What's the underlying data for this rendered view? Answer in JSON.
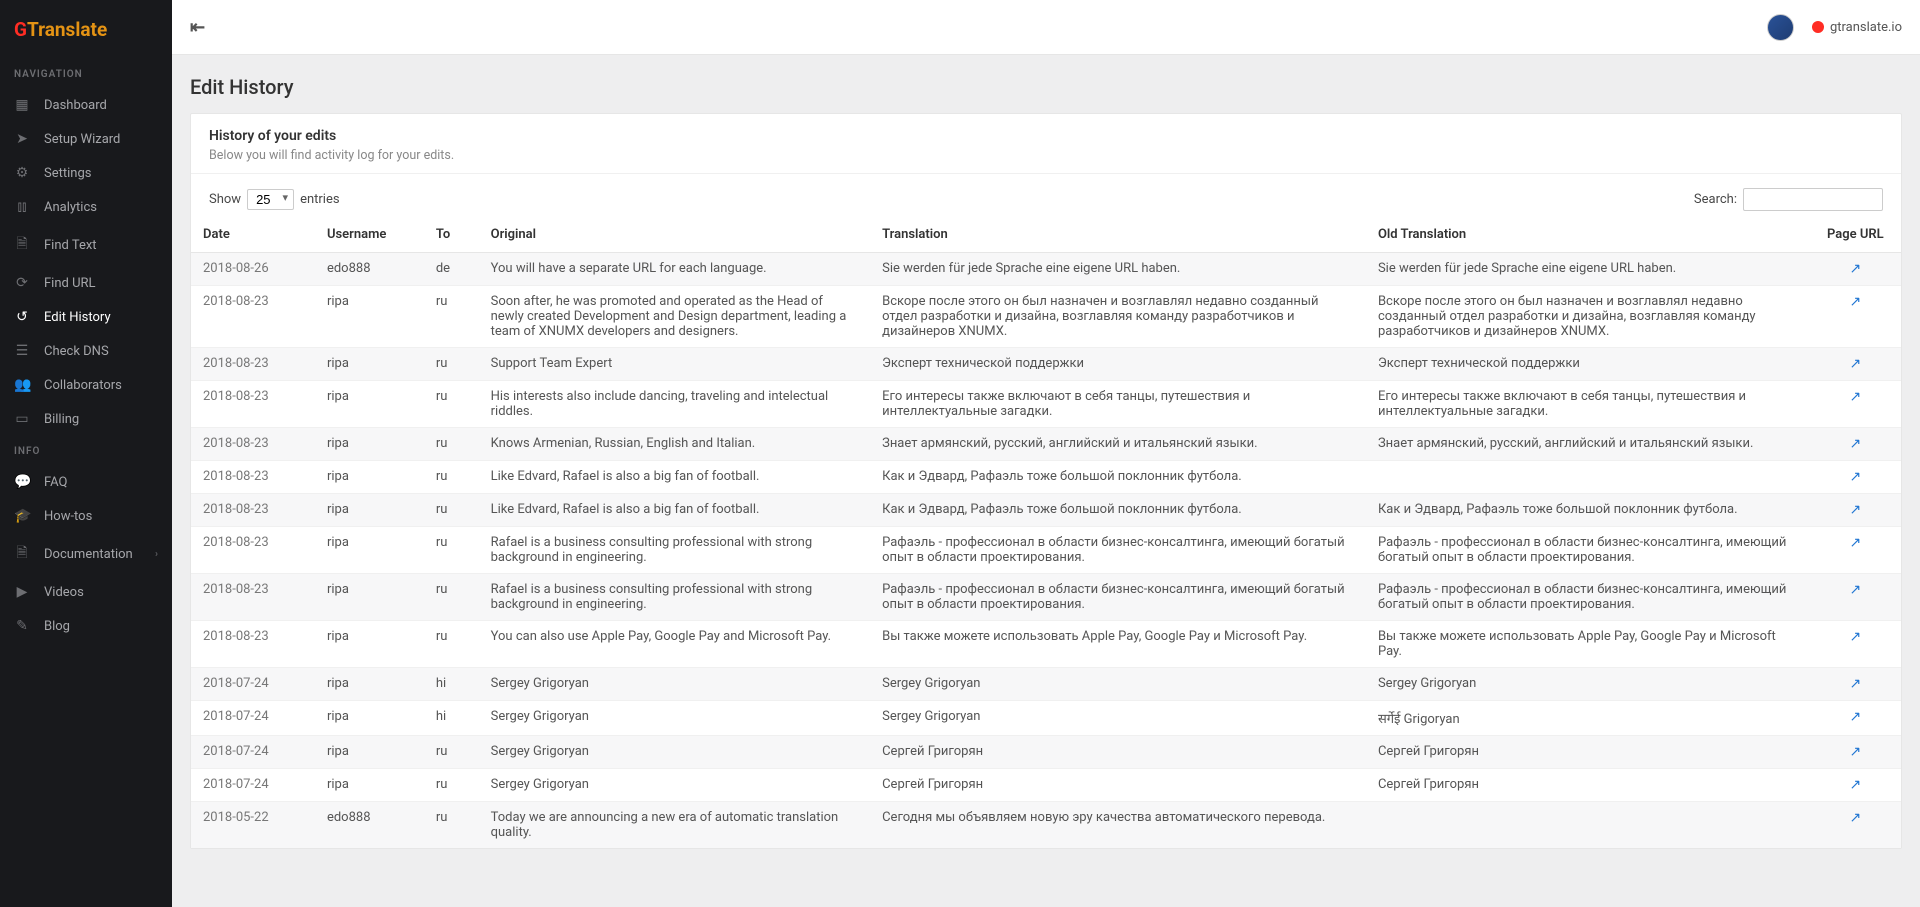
{
  "logo": {
    "gt": "G",
    "rest": "Translate"
  },
  "nav_sections": {
    "navigation_label": "NAVIGATION",
    "info_label": "INFO"
  },
  "nav": {
    "dashboard": "Dashboard",
    "setup_wizard": "Setup Wizard",
    "settings": "Settings",
    "analytics": "Analytics",
    "find_text": "Find Text",
    "find_url": "Find URL",
    "edit_history": "Edit History",
    "check_dns": "Check DNS",
    "collaborators": "Collaborators",
    "billing": "Billing",
    "faq": "FAQ",
    "howtos": "How-tos",
    "documentation": "Documentation",
    "videos": "Videos",
    "blog": "Blog"
  },
  "topbar": {
    "brand_link": "gtranslate.io"
  },
  "page": {
    "title": "Edit History",
    "panel_title": "History of your edits",
    "panel_sub": "Below you will find activity log for your edits."
  },
  "controls": {
    "show_label": "Show",
    "entries_label": "entries",
    "page_size": "25",
    "search_label": "Search:",
    "search_value": ""
  },
  "columns": {
    "date": "Date",
    "username": "Username",
    "to": "To",
    "original": "Original",
    "translation": "Translation",
    "old_translation": "Old Translation",
    "page_url": "Page URL"
  },
  "rows": [
    {
      "date": "2018-08-26",
      "user": "edo888",
      "to": "de",
      "orig": "You will have a separate URL for each language.",
      "trans": "Sie werden für jede Sprache eine eigene URL haben.",
      "old": "Sie werden für jede Sprache eine eigene URL haben."
    },
    {
      "date": "2018-08-23",
      "user": "ripa",
      "to": "ru",
      "orig": "Soon after, he was promoted and operated as the Head of newly created Development and Design department, leading a team of XNUMX developers and designers.",
      "trans": "Вскоре после этого он был назначен и возглавлял недавно созданный отдел разработки и дизайна, возглавляя команду разработчиков и дизайнеров XNUMX.",
      "old": "Вскоре после этого он был назначен и возглавлял недавно созданный отдел разработки и дизайна, возглавляя команду разработчиков и дизайнеров XNUMX."
    },
    {
      "date": "2018-08-23",
      "user": "ripa",
      "to": "ru",
      "orig": "Support Team Expert",
      "trans": "Эксперт технической поддержки",
      "old": "Эксперт технической поддержки"
    },
    {
      "date": "2018-08-23",
      "user": "ripa",
      "to": "ru",
      "orig": "His interests also include dancing, traveling and intelectual riddles.",
      "trans": "Его интересы также включают в себя танцы, путешествия и интеллектуальные загадки.",
      "old": "Его интересы также включают в себя танцы, путешествия и интеллектуальные загадки."
    },
    {
      "date": "2018-08-23",
      "user": "ripa",
      "to": "ru",
      "orig": "Knows Armenian, Russian, English and Italian.",
      "trans": "Знает армянский, русский, английский и итальянский языки.",
      "old": "Знает армянский, русский, английский и итальянский языки."
    },
    {
      "date": "2018-08-23",
      "user": "ripa",
      "to": "ru",
      "orig": "Like Edvard, Rafael is also a big fan of football.",
      "trans": "Как и Эдвард, Рафаэль тоже большой поклонник футбола.",
      "old": ""
    },
    {
      "date": "2018-08-23",
      "user": "ripa",
      "to": "ru",
      "orig": "Like Edvard, Rafael is also a big fan of football.",
      "trans": "Как и Эдвард, Рафаэль тоже большой поклонник футбола.",
      "old": "Как и Эдвард, Рафаэль тоже большой поклонник футбола."
    },
    {
      "date": "2018-08-23",
      "user": "ripa",
      "to": "ru",
      "orig": "Rafael is a business consulting professional with strong background in engineering.",
      "trans": "Рафаэль - профессионал в области бизнес-консалтинга, имеющий богатый опыт в области проектирования.",
      "old": "Рафаэль - профессионал в области бизнес-консалтинга, имеющий богатый опыт в области проектирования."
    },
    {
      "date": "2018-08-23",
      "user": "ripa",
      "to": "ru",
      "orig": "Rafael is a business consulting professional with strong background in engineering.",
      "trans": "Рафаэль - профессионал в области бизнес-консалтинга, имеющий богатый опыт в области проектирования.",
      "old": "Рафаэль - профессионал в области бизнес-консалтинга, имеющий богатый опыт в области проектирования."
    },
    {
      "date": "2018-08-23",
      "user": "ripa",
      "to": "ru",
      "orig": "You can also use Apple Pay, Google Pay and Microsoft Pay.",
      "trans": "Вы также можете использовать Apple Pay, Google Pay и Microsoft Pay.",
      "old": "Вы также можете использовать Apple Pay, Google Pay и Microsoft Pay."
    },
    {
      "date": "2018-07-24",
      "user": "ripa",
      "to": "hi",
      "orig": "Sergey Grigoryan",
      "trans": "Sergey Grigoryan",
      "old": "Sergey Grigoryan"
    },
    {
      "date": "2018-07-24",
      "user": "ripa",
      "to": "hi",
      "orig": "Sergey Grigoryan",
      "trans": "Sergey Grigoryan",
      "old": "सर्गेई Grigoryan"
    },
    {
      "date": "2018-07-24",
      "user": "ripa",
      "to": "ru",
      "orig": "Sergey Grigoryan",
      "trans": "Сергей Григорян",
      "old": "Сергей Григорян"
    },
    {
      "date": "2018-07-24",
      "user": "ripa",
      "to": "ru",
      "orig": "Sergey Grigoryan",
      "trans": "Сергей Григорян",
      "old": "Сергей Григорян"
    },
    {
      "date": "2018-05-22",
      "user": "edo888",
      "to": "ru",
      "orig": "Today we are announcing a new era of automatic translation quality.",
      "trans": "Сегодня мы объявляем новую эру качества автоматического перевода.",
      "old": ""
    }
  ]
}
